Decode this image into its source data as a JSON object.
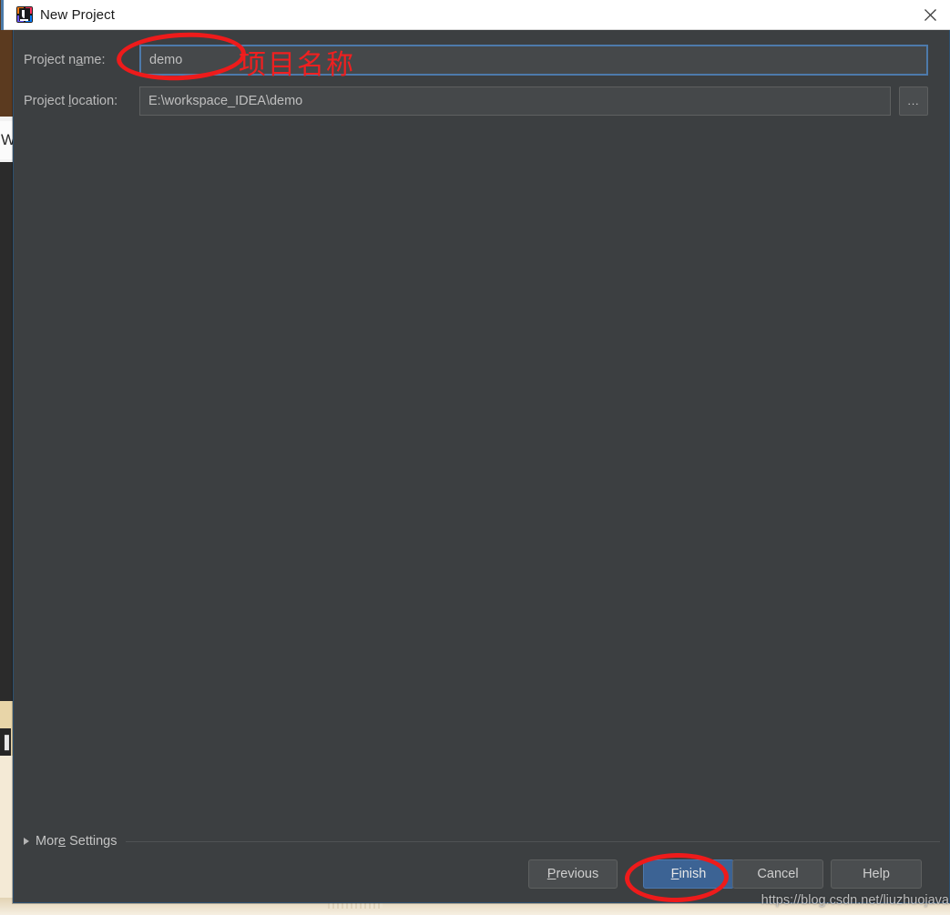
{
  "window": {
    "title": "New Project",
    "icon": "intellij-idea-logo-icon",
    "close_label": "×"
  },
  "form": {
    "project_name": {
      "label": "Project name:",
      "label_mnemonic": "a",
      "value": "demo",
      "placeholder": "Project name"
    },
    "project_location": {
      "label": "Project location:",
      "label_mnemonic": "l",
      "value": "E:\\workspace_IDEA\\demo",
      "placeholder": "Project location",
      "browse_label": "..."
    }
  },
  "more_settings": {
    "label": "More Settings",
    "label_mnemonic": "e",
    "expanded": false,
    "arrow": "triangle-right-icon"
  },
  "buttons": {
    "previous": "Previous",
    "previous_mnemonic": "P",
    "finish": "Finish",
    "finish_mnemonic": "F",
    "cancel": "Cancel",
    "help": "Help"
  },
  "annotations": {
    "project_name_text": "项目名称",
    "ellipse_color": "#ee1b1b",
    "ellipse_targets": [
      "project-name-field",
      "finish-button"
    ]
  },
  "watermark": {
    "text": "https://blog.csdn.net/liuzhuojava"
  },
  "background": {
    "left_fragment_text": "W",
    "left_icon_text": "▐"
  },
  "colors": {
    "dialog_bg": "#3c3f41",
    "input_bg": "#45484a",
    "focus_border": "#4d7aab",
    "default_button_bg": "#3c6394",
    "titlebar_bg": "#ffffff",
    "annotation_red": "#ee1b1b"
  }
}
